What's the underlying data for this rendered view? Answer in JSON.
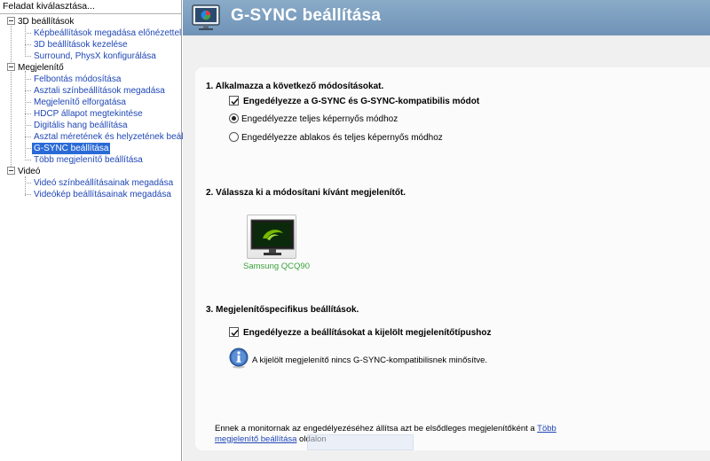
{
  "left_panel": {
    "header": "Feladat kiválasztása...",
    "categories": [
      {
        "label": "3D beállítások",
        "items": [
          {
            "label": "Képbeállítások megadása előnézettel"
          },
          {
            "label": "3D beállítások kezelése"
          },
          {
            "label": "Surround, PhysX konfigurálása"
          }
        ]
      },
      {
        "label": "Megjelenítő",
        "items": [
          {
            "label": "Felbontás módosítása"
          },
          {
            "label": "Asztali színbeállítások megadása"
          },
          {
            "label": "Megjelenítő elforgatása"
          },
          {
            "label": "HDCP állapot megtekintése"
          },
          {
            "label": "Digitális hang beállítása"
          },
          {
            "label": "Asztal méretének és helyzetének beállítása"
          },
          {
            "label": "G-SYNC beállítása",
            "selected": true
          },
          {
            "label": "Több megjelenítő beállítása"
          }
        ]
      },
      {
        "label": "Videó",
        "items": [
          {
            "label": "Videó színbeállításainak megadása"
          },
          {
            "label": "Videókép beállításainak megadása"
          }
        ]
      }
    ]
  },
  "banner": {
    "title": "G-SYNC beállítása",
    "icon": "display-settings-icon"
  },
  "section1": {
    "title": "1. Alkalmazza a következő módosításokat.",
    "enable_checkbox": {
      "label": "Engedélyezze a G-SYNC és G-SYNC-kompatibilis módot",
      "checked": true
    },
    "radios": [
      {
        "label": "Engedélyezze teljes képernyős módhoz",
        "selected": true
      },
      {
        "label": "Engedélyezze ablakos és teljes képernyős módhoz",
        "selected": false
      }
    ]
  },
  "section2": {
    "title": "2. Válassza ki a módosítani kívánt megjelenítőt.",
    "display": {
      "name": "Samsung QCQ90",
      "icon": "nvidia-monitor-icon"
    }
  },
  "section3": {
    "title": "3. Megjelenítőspecifikus beállítások.",
    "checkbox": {
      "label": "Engedélyezze a beállításokat a kijelölt megjelenítőtípushoz",
      "checked": true
    },
    "info": {
      "icon": "info-icon",
      "text": "A kijelölt megjelenítő nincs G-SYNC-kompatibilisnek minősítve."
    }
  },
  "footer": {
    "text_before": "Ennek a monitornak az engedélyezéséhez állítsa azt be elsődleges megjelenítőként a ",
    "link": "Több megjelenítő beállítása",
    "text_after": " oldalon"
  },
  "colors": {
    "link": "#1f47b6",
    "selection": "#2a6ad6",
    "banner": "#7a9ec2",
    "display_label": "#3aa23a",
    "nvidia_green": "#76b900"
  }
}
